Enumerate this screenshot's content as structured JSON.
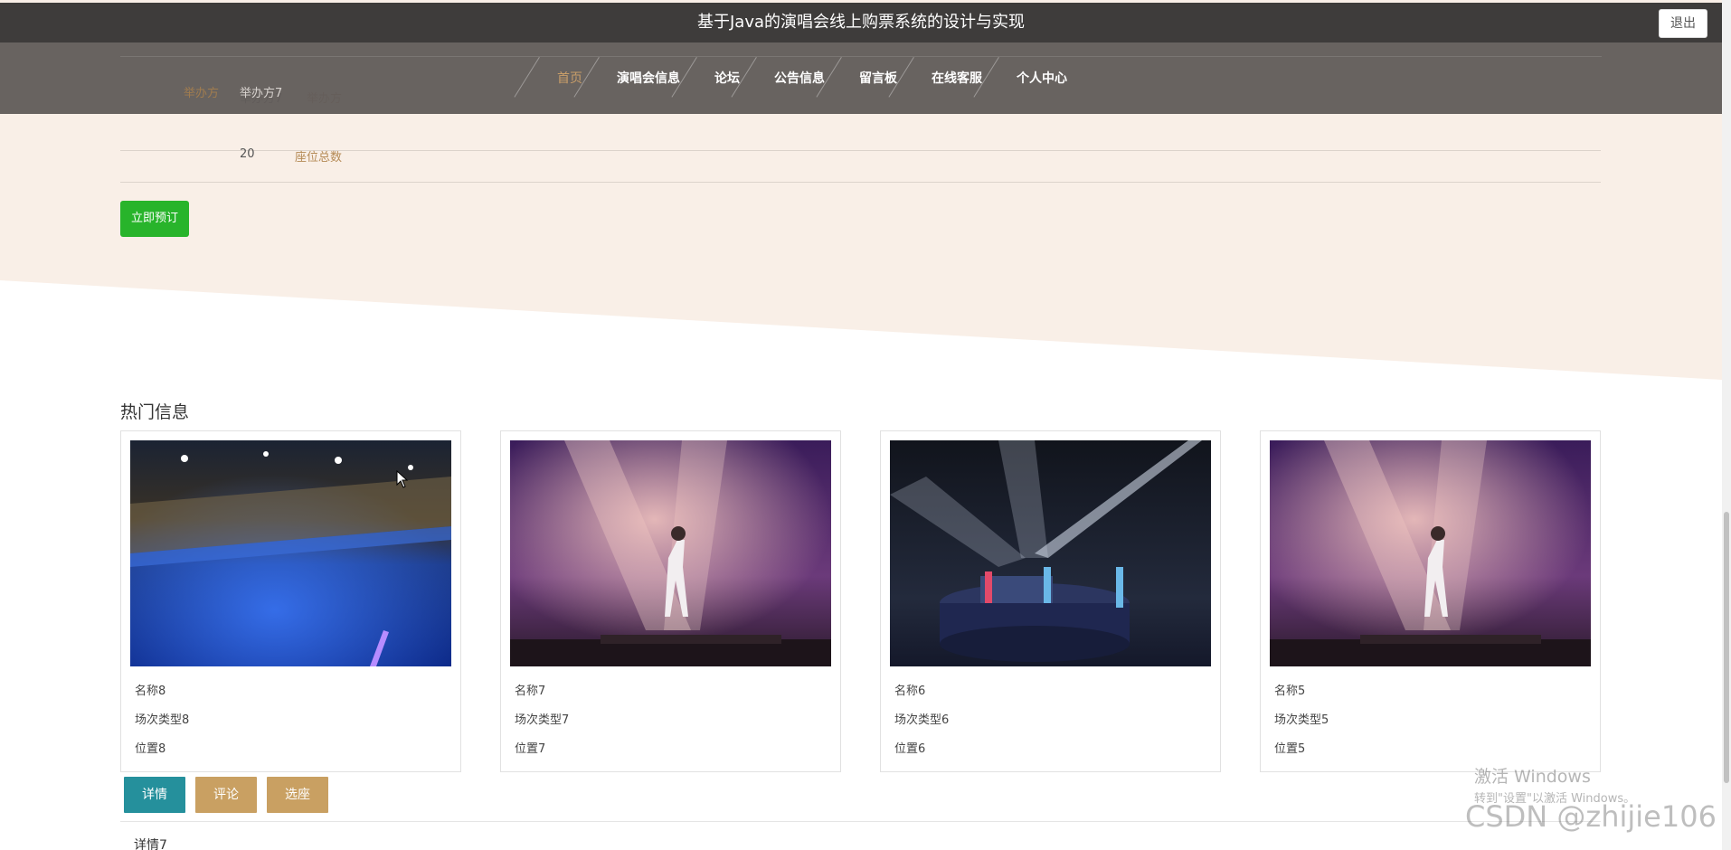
{
  "header": {
    "title": "基于Java的演唱会线上购票系统的设计与实现",
    "logout_label": "退出"
  },
  "nav": {
    "items": [
      "首页",
      "演唱会信息",
      "论坛",
      "公告信息",
      "留言板",
      "在线客服",
      "个人中心"
    ],
    "active": "首页"
  },
  "detail": {
    "fields": [
      {
        "label": "举办方",
        "value": "举办方7"
      },
      {
        "label": "座位总数",
        "value": "20"
      }
    ],
    "book_label": "立即预订"
  },
  "hot": {
    "title": "热门信息",
    "cards": [
      {
        "name": "名称8",
        "type": "场次类型8",
        "location": "位置8",
        "image": "arena-crowd-photo"
      },
      {
        "name": "名称7",
        "type": "场次类型7",
        "location": "位置7",
        "image": "stage-singer-photo"
      },
      {
        "name": "名称6",
        "type": "场次类型6",
        "location": "位置6",
        "image": "stage-spotlight-photo"
      },
      {
        "name": "名称5",
        "type": "场次类型5",
        "location": "位置5",
        "image": "stage-singer-photo"
      }
    ]
  },
  "tabs": {
    "items": [
      "详情",
      "评论",
      "选座"
    ],
    "active": "详情",
    "detail_heading": "详情7"
  },
  "overlay": {
    "activate_title": "激活 Windows",
    "activate_hint": "转到\"设置\"以激活 Windows。",
    "csdn": "CSDN @zhijie106"
  },
  "colors": {
    "accent_gold": "#c99e69",
    "book_green": "#28b42b",
    "tab_teal": "#25909c",
    "tab_gold": "#c9a062",
    "detail_bg": "#f9efe7"
  }
}
